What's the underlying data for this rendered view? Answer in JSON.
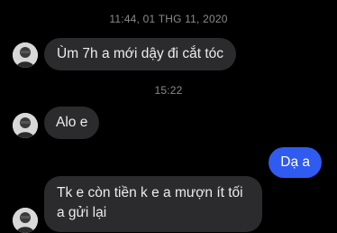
{
  "chat": {
    "timestamps": [
      "11:44, 01 THG 11, 2020",
      "15:22"
    ],
    "messages": [
      {
        "from": "them",
        "text": "Ùm 7h a mới dậy đi cắt tóc"
      },
      {
        "from": "them",
        "text": "Alo e"
      },
      {
        "from": "me",
        "text": "Dạ a"
      },
      {
        "from": "them",
        "text": "Tk e còn tiền k e a mượn ít tối a gửi lại"
      }
    ]
  },
  "colors": {
    "background": "#000000",
    "incoming_bubble": "#2b2b2d",
    "outgoing_bubble": "#2f5bf0",
    "timestamp_text": "#8a8a8e"
  },
  "icons": {
    "avatar": "contact-avatar-photo"
  }
}
